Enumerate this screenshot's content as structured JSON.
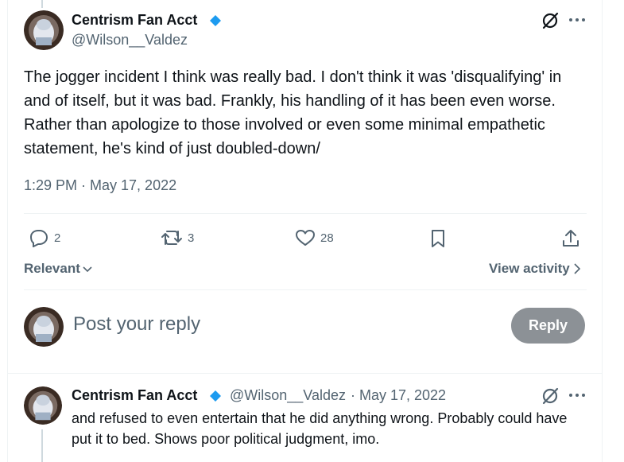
{
  "main_tweet": {
    "display_name": "Centrism Fan Acct",
    "handle": "@Wilson__Valdez",
    "text": "The jogger incident I think was really bad. I don't think it was 'disqualifying' in and of itself, but it was bad. Frankly, his handling of it has been even worse. Rather than apologize to those involved or even some minimal empathetic statement, he's kind of just doubled-down/",
    "timestamp": "1:29 PM · May 17, 2022",
    "actions": {
      "replies": "2",
      "retweets": "3",
      "likes": "28"
    }
  },
  "sort": {
    "relevant_label": "Relevant",
    "view_activity_label": "View activity"
  },
  "composer": {
    "placeholder": "Post your reply",
    "reply_button": "Reply"
  },
  "reply_tweet": {
    "display_name": "Centrism Fan Acct",
    "handle": "@Wilson__Valdez",
    "separator": "·",
    "date": "May 17, 2022",
    "text": "and refused to even entertain that he did anything wrong. Probably could have put it to bed. Shows poor political judgment, imo."
  },
  "colors": {
    "verified_badge": "#1d9bf0",
    "muted_text": "#536471",
    "reply_button_bg": "#8c9196"
  },
  "icons": [
    "grok-icon",
    "more-icon",
    "reply-icon",
    "retweet-icon",
    "like-icon",
    "bookmark-icon",
    "share-icon",
    "chevron-down-icon",
    "chevron-right-icon",
    "verified-badge-icon"
  ]
}
